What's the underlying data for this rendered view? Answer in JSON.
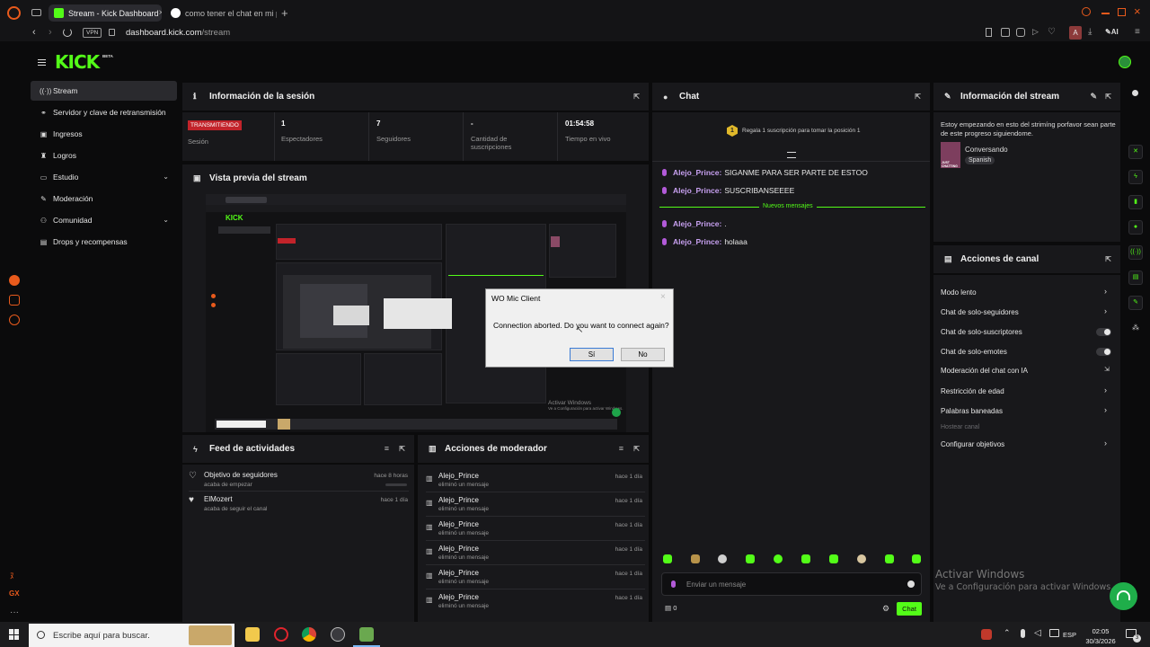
{
  "browser": {
    "tabs": [
      {
        "title": "Stream - Kick Dashboard",
        "active": true
      },
      {
        "title": "como tener el chat en mi p",
        "active": false
      }
    ],
    "vpn_label": "VPN",
    "url_host": "dashboard.kick.com",
    "url_path": "/stream",
    "ai_label": "AI"
  },
  "app": {
    "logo": "KICK",
    "beta": "BETA",
    "accent": "#53fc18",
    "sidebar": [
      {
        "label": "Stream",
        "icon": "broadcast-icon",
        "active": true,
        "chevron": false
      },
      {
        "label": "Servidor y clave de retransmisión",
        "icon": "link-icon",
        "active": false,
        "chevron": false
      },
      {
        "label": "Ingresos",
        "icon": "money-icon",
        "active": false,
        "chevron": false
      },
      {
        "label": "Logros",
        "icon": "trophy-icon",
        "active": false,
        "chevron": false
      },
      {
        "label": "Estudio",
        "icon": "studio-icon",
        "active": false,
        "chevron": true
      },
      {
        "label": "Moderación",
        "icon": "wrench-icon",
        "active": false,
        "chevron": false
      },
      {
        "label": "Comunidad",
        "icon": "community-icon",
        "active": false,
        "chevron": true
      },
      {
        "label": "Drops y recompensas",
        "icon": "gift-icon",
        "active": false,
        "chevron": false
      }
    ]
  },
  "session": {
    "title": "Información de la sesión",
    "live_badge": "TRANSMITIENDO",
    "session_label": "Sesión",
    "stats": [
      {
        "value": "1",
        "label": "Espectadores"
      },
      {
        "value": "7",
        "label": "Seguidores"
      },
      {
        "value": "-",
        "label": "Cantidad de suscripciones"
      },
      {
        "value": "01:54:58",
        "label": "Tiempo en vivo"
      }
    ]
  },
  "preview": {
    "title": "Vista previa del stream",
    "watermark_line1": "Activar Windows",
    "watermark_line2": "Ve a Configuración para activar Windows."
  },
  "feed": {
    "title": "Feed de actividades",
    "items": [
      {
        "title": "Objetivo de seguidores",
        "sub": "acaba de empezar",
        "time": "hace 8 horas"
      },
      {
        "title": "ElMozert",
        "sub": "acaba de seguir el canal",
        "time": "hace 1 día"
      }
    ]
  },
  "modactions": {
    "title": "Acciones de moderador",
    "rows": [
      {
        "user": "Alejo_Prince",
        "action": "eliminó un mensaje",
        "time": "hace 1 día"
      },
      {
        "user": "Alejo_Prince",
        "action": "eliminó un mensaje",
        "time": "hace 1 día"
      },
      {
        "user": "Alejo_Prince",
        "action": "eliminó un mensaje",
        "time": "hace 1 día"
      },
      {
        "user": "Alejo_Prince",
        "action": "eliminó un mensaje",
        "time": "hace 1 día"
      },
      {
        "user": "Alejo_Prince",
        "action": "eliminó un mensaje",
        "time": "hace 1 día"
      },
      {
        "user": "Alejo_Prince",
        "action": "eliminó un mensaje",
        "time": "hace 1 día"
      }
    ]
  },
  "chat": {
    "title": "Chat",
    "gift_rank": "1",
    "gift_text": "Regala 1 suscripción para tomar la posición 1",
    "messages": [
      {
        "user": "Alejo_Prince:",
        "text": "SIGANME PARA SER PARTE DE ESTOO"
      },
      {
        "user": "Alejo_Prince:",
        "text": "SUSCRIBANSEEEE"
      }
    ],
    "new_messages_label": "Nuevos mensajes",
    "new_messages": [
      {
        "user": "Alejo_Prince:",
        "text": "."
      },
      {
        "user": "Alejo_Prince:",
        "text": "holaaa"
      }
    ],
    "input_placeholder": "Enviar un mensaje",
    "points": "0",
    "send_label": "Chat"
  },
  "stream_info": {
    "title": "Información del stream",
    "description": "Estoy empezando en esto del strimíng porfavor sean parte de este progreso siguiendome.",
    "category": "Conversando",
    "language": "Spanish",
    "thumb_text": "JUST CHATTING"
  },
  "channel_actions": {
    "title": "Acciones de canal",
    "items": [
      {
        "label": "Modo lento",
        "control": "chevron"
      },
      {
        "label": "Chat de solo-seguidores",
        "control": "chevron"
      },
      {
        "label": "Chat de solo-suscriptores",
        "control": "toggle"
      },
      {
        "label": "Chat de solo-emotes",
        "control": "toggle"
      },
      {
        "label": "Moderación del chat con IA",
        "control": "external"
      },
      {
        "label": "Restricción de edad",
        "control": "chevron"
      },
      {
        "label": "Palabras baneadas",
        "control": "chevron"
      },
      {
        "label": "Hostear canal",
        "control": "disabled"
      },
      {
        "label": "Configurar objetivos",
        "control": "chevron"
      }
    ]
  },
  "windows_watermark": {
    "line1": "Activar Windows",
    "line2": "Ve a Configuración para activar Windows."
  },
  "dialog": {
    "title": "WO Mic Client",
    "message": "Connection aborted. Do you want to connect again?",
    "yes": "Sí",
    "no": "No"
  },
  "taskbar": {
    "search_placeholder": "Escribe aquí para buscar.",
    "lang": "ESP",
    "time": "02:05",
    "date": "30/3/2026",
    "notif_count": "3"
  }
}
